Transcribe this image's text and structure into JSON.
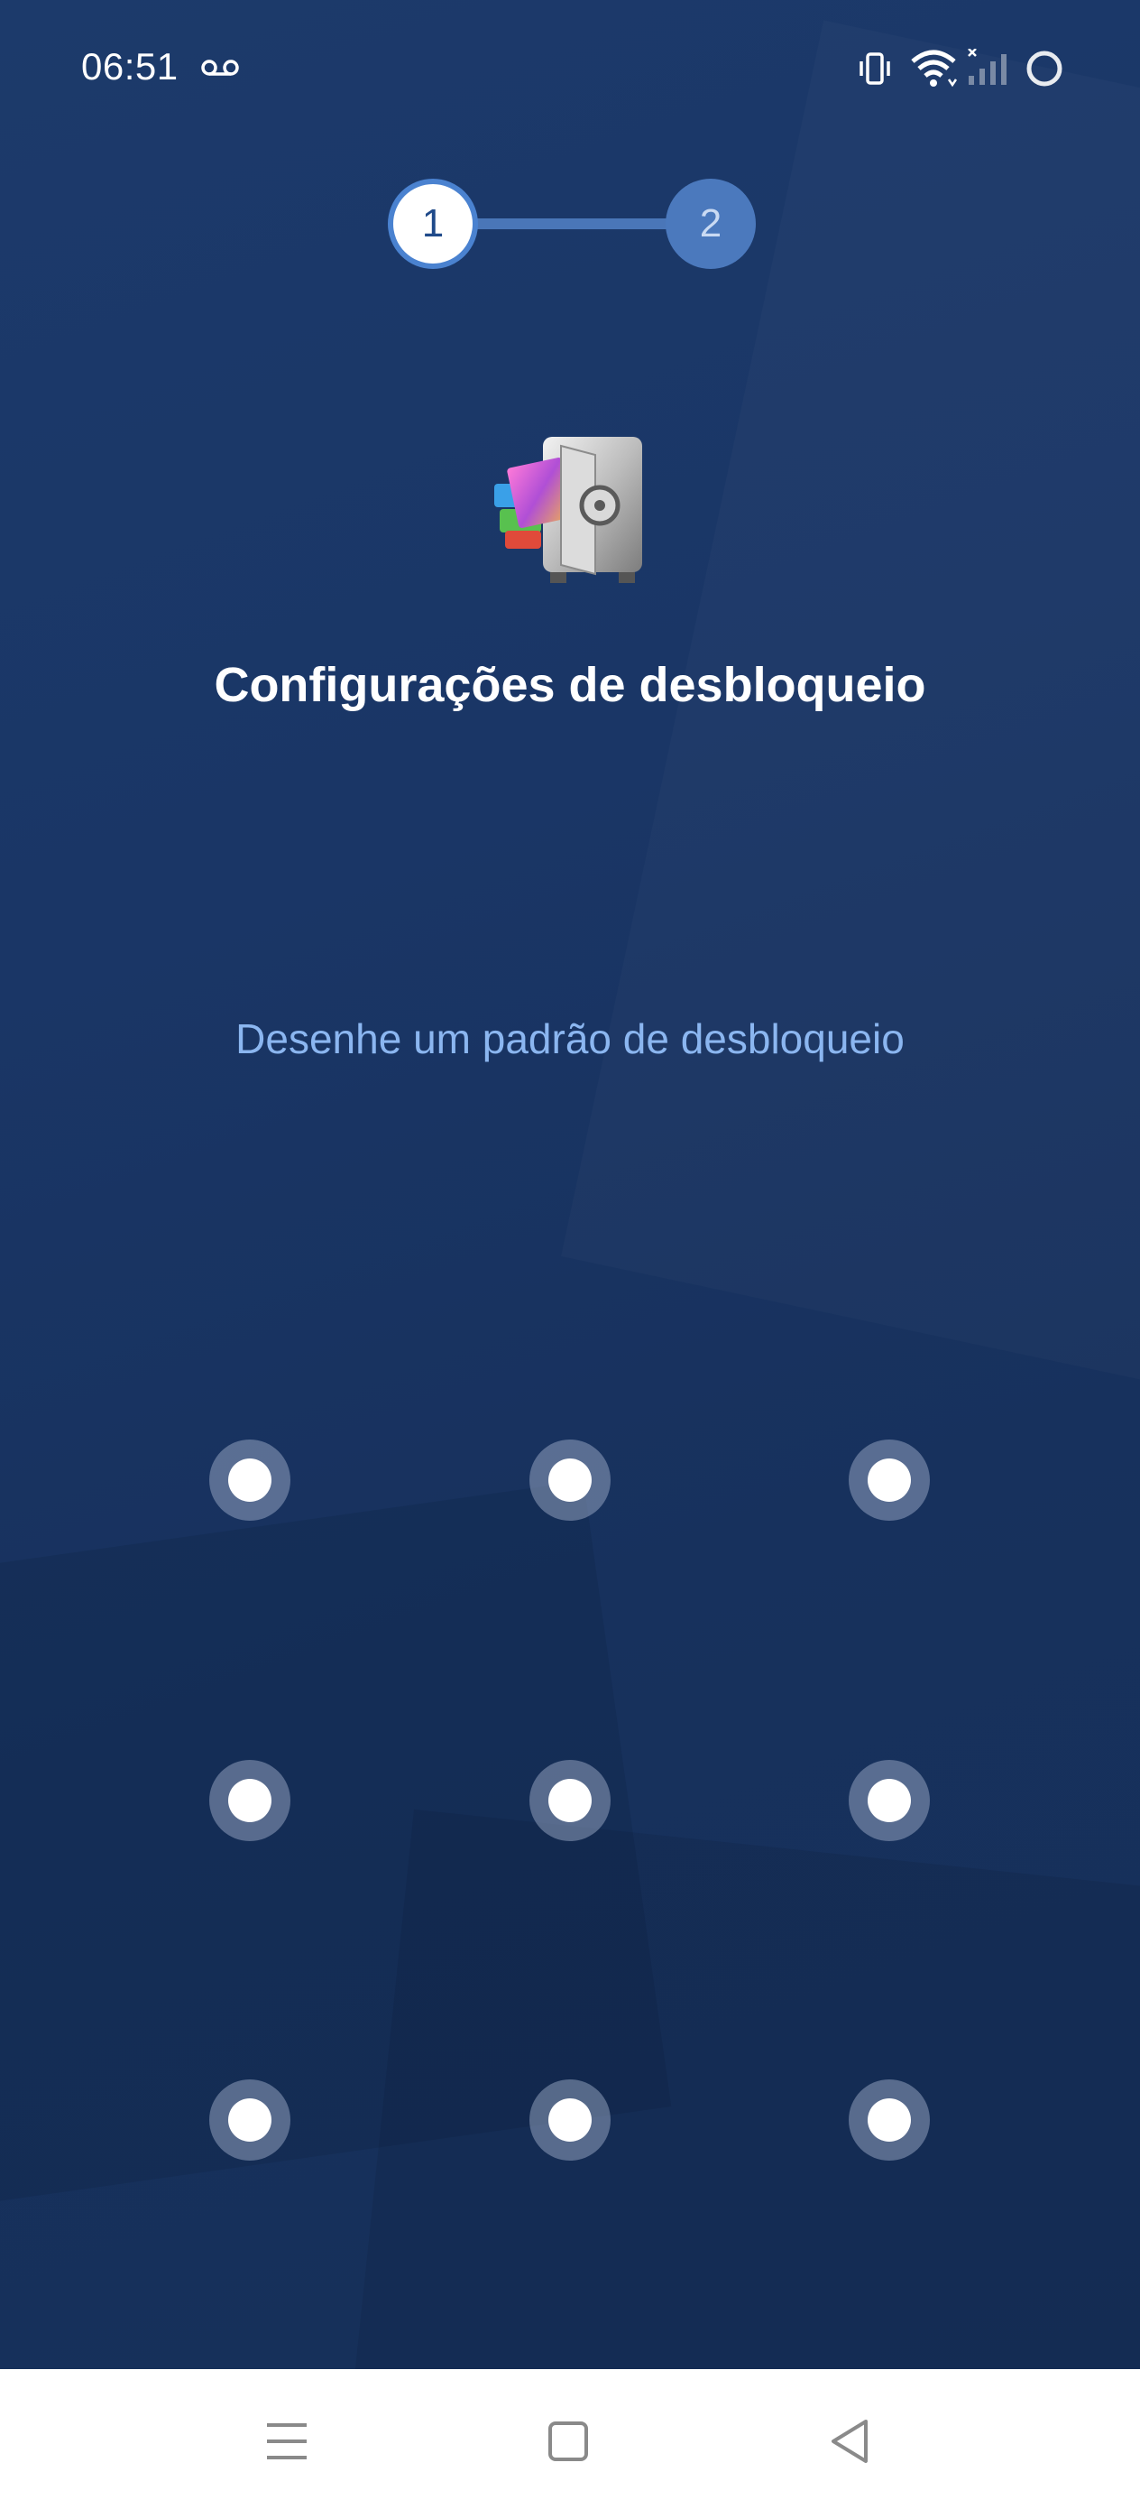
{
  "status_bar": {
    "time": "06:51",
    "icons": [
      "voicemail-icon",
      "vibrate-icon",
      "wifi-icon",
      "cellular-no-signal-icon",
      "loading-ring-icon"
    ]
  },
  "stepper": {
    "steps": [
      "1",
      "2"
    ],
    "active_step": 1
  },
  "app_icon": "safe-vault-icon",
  "title": "Configurações de desbloqueio",
  "subtitle": "Desenhe um padrão de desbloqueio",
  "pattern_dots": 9,
  "nav_bar": {
    "icons": [
      "menu-icon",
      "home-icon",
      "back-icon"
    ]
  },
  "colors": {
    "background": "#1b3767",
    "stepper_active": "#ffffff",
    "stepper_inactive": "#4b79bd",
    "subtitle": "#8bb6f0"
  }
}
